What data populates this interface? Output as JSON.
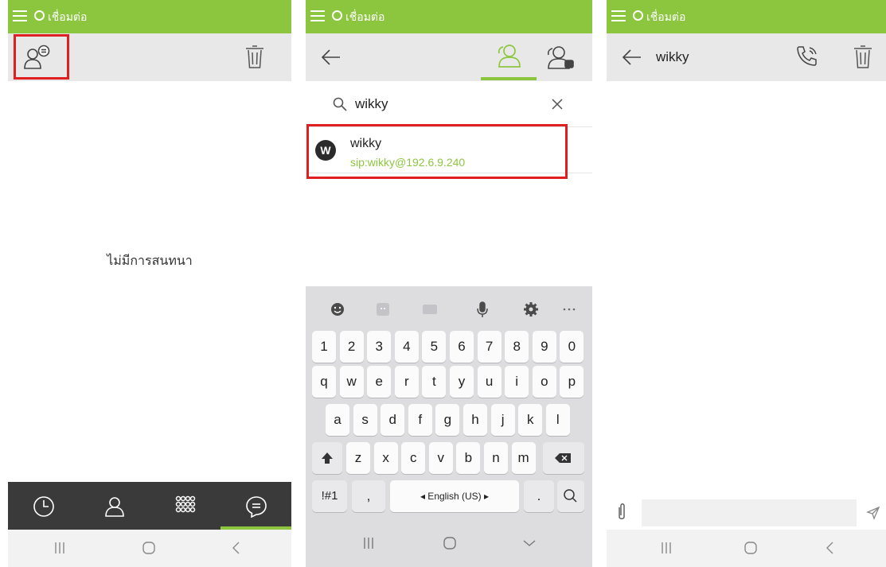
{
  "status_bar": {
    "connection_label": "เชื่อมต่อ"
  },
  "screen1": {
    "empty_message": "ไม่มีการสนทนา",
    "nav": [
      "history",
      "contacts",
      "dialpad",
      "chat"
    ],
    "active_nav": "chat"
  },
  "screen2": {
    "search": {
      "value": "wikky",
      "placeholder": ""
    },
    "result": {
      "initial": "W",
      "name": "wikky",
      "sip": "sip:wikky@192.6.9.240"
    },
    "keyboard": {
      "row_numbers": [
        "1",
        "2",
        "3",
        "4",
        "5",
        "6",
        "7",
        "8",
        "9",
        "0"
      ],
      "row_top": [
        "q",
        "w",
        "e",
        "r",
        "t",
        "y",
        "u",
        "i",
        "o",
        "p"
      ],
      "row_mid": [
        "a",
        "s",
        "d",
        "f",
        "g",
        "h",
        "j",
        "k",
        "l"
      ],
      "row_low": [
        "z",
        "x",
        "c",
        "v",
        "b",
        "n",
        "m"
      ],
      "symbols_key": "!#1",
      "comma_key": ",",
      "space_key": "◂ English (US) ▸",
      "period_key": "."
    }
  },
  "screen3": {
    "contact_name": "wikky",
    "message_input": {
      "value": "",
      "placeholder": ""
    }
  },
  "colors": {
    "accent": "#8cc63f",
    "highlight": "#e02020",
    "nav_bg": "#3a3a3a",
    "toolbar_bg": "#e8e8e8"
  }
}
